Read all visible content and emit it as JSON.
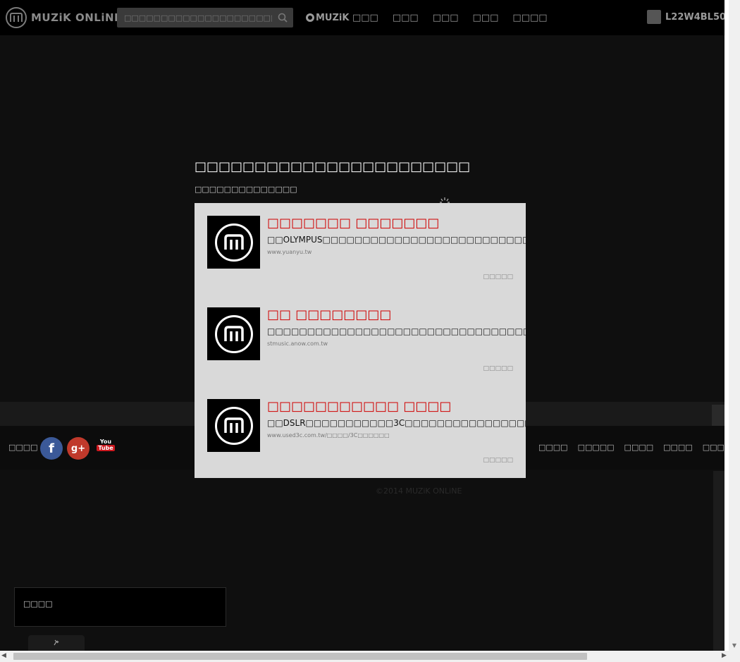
{
  "header": {
    "logo_text": "MUZiK ONLiNE",
    "search_placeholder": "□□□□□□□□□□□□□□□□□□□□□□□□",
    "nav": [
      {
        "label": "MUZiK □□□",
        "icon": "muzik-dot-icon"
      },
      {
        "label": "□□□"
      },
      {
        "label": "□□□"
      },
      {
        "label": "□□□"
      },
      {
        "label": "□□□□"
      }
    ],
    "username": "L22W4BL508"
  },
  "overlay": {
    "title": "□□□□□□□□□□□□□□□□□□□□□□□",
    "subtitle": "□□□□□□□□□□□□□□"
  },
  "ads": [
    {
      "title": "□□□□□□□ □□□□□□□",
      "description": "□□OLYMPUS□□□□□□□□□□□□□□□□□□□□□□□□□□□□□□□□□",
      "url": "www.yuanyu.tw",
      "more": "□□□□□"
    },
    {
      "title": "□□ □□□□□□□□",
      "description": "□□□□□□□□□□□□□□□□□□□□□□□□□□□□□□□□□□□□□□□□□□",
      "url": "stmusic.anow.com.tw",
      "more": "□□□□□"
    },
    {
      "title": "□□□□□□□□□□□ □□□□",
      "description": "□□DSLR□□□□□□□□□□□3C□□□□□□□□□□□□□□□□□□□□□□",
      "url": "www.used3c.com.tw/□□□□/3C□□□□□□",
      "more": "□□□□□"
    }
  ],
  "footer": {
    "follow_label": "□□□□",
    "social": [
      {
        "name": "facebook",
        "glyph": "f"
      },
      {
        "name": "google-plus",
        "glyph": "g+"
      },
      {
        "name": "youtube",
        "you": "You",
        "tube": "Tube"
      }
    ],
    "links": [
      "□□□□",
      "□□□□□",
      "□□□□",
      "□□□□",
      "□□□□",
      "□□□"
    ],
    "copyright": "©2014 MUZiK ONLiNE"
  },
  "chat": {
    "title": "□□□□",
    "pin_icon": "pin-icon"
  }
}
